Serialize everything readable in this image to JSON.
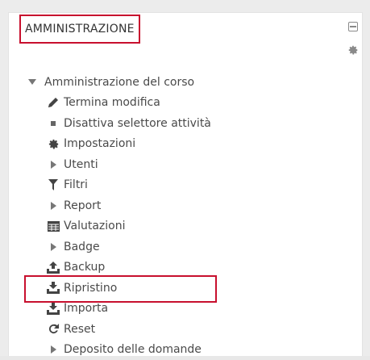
{
  "block": {
    "title": "AMMINISTRAZIONE",
    "controls": {
      "dock_icon": "dock-icon",
      "actions_icon": "gear-icon"
    }
  },
  "tree": {
    "root": {
      "label": "Amministrazione del corso",
      "icon": "caret-down-icon"
    },
    "items": [
      {
        "label": "Termina modifica",
        "icon": "pencil-icon"
      },
      {
        "label": "Disattiva selettore attività",
        "icon": "square-bullet-icon"
      },
      {
        "label": "Impostazioni",
        "icon": "gear-icon"
      },
      {
        "label": "Utenti",
        "icon": "caret-right-icon"
      },
      {
        "label": "Filtri",
        "icon": "filter-icon"
      },
      {
        "label": "Report",
        "icon": "caret-right-icon"
      },
      {
        "label": "Valutazioni",
        "icon": "table-icon"
      },
      {
        "label": "Badge",
        "icon": "caret-right-icon"
      },
      {
        "label": "Backup",
        "icon": "upload-icon"
      },
      {
        "label": "Ripristino",
        "icon": "download-icon"
      },
      {
        "label": "Importa",
        "icon": "download-icon"
      },
      {
        "label": "Reset",
        "icon": "refresh-icon"
      },
      {
        "label": "Deposito delle domande",
        "icon": "caret-right-icon"
      }
    ]
  },
  "colors": {
    "highlight": "#c8102e",
    "text": "#4a4a4a",
    "icon": "#4a4a4a"
  }
}
